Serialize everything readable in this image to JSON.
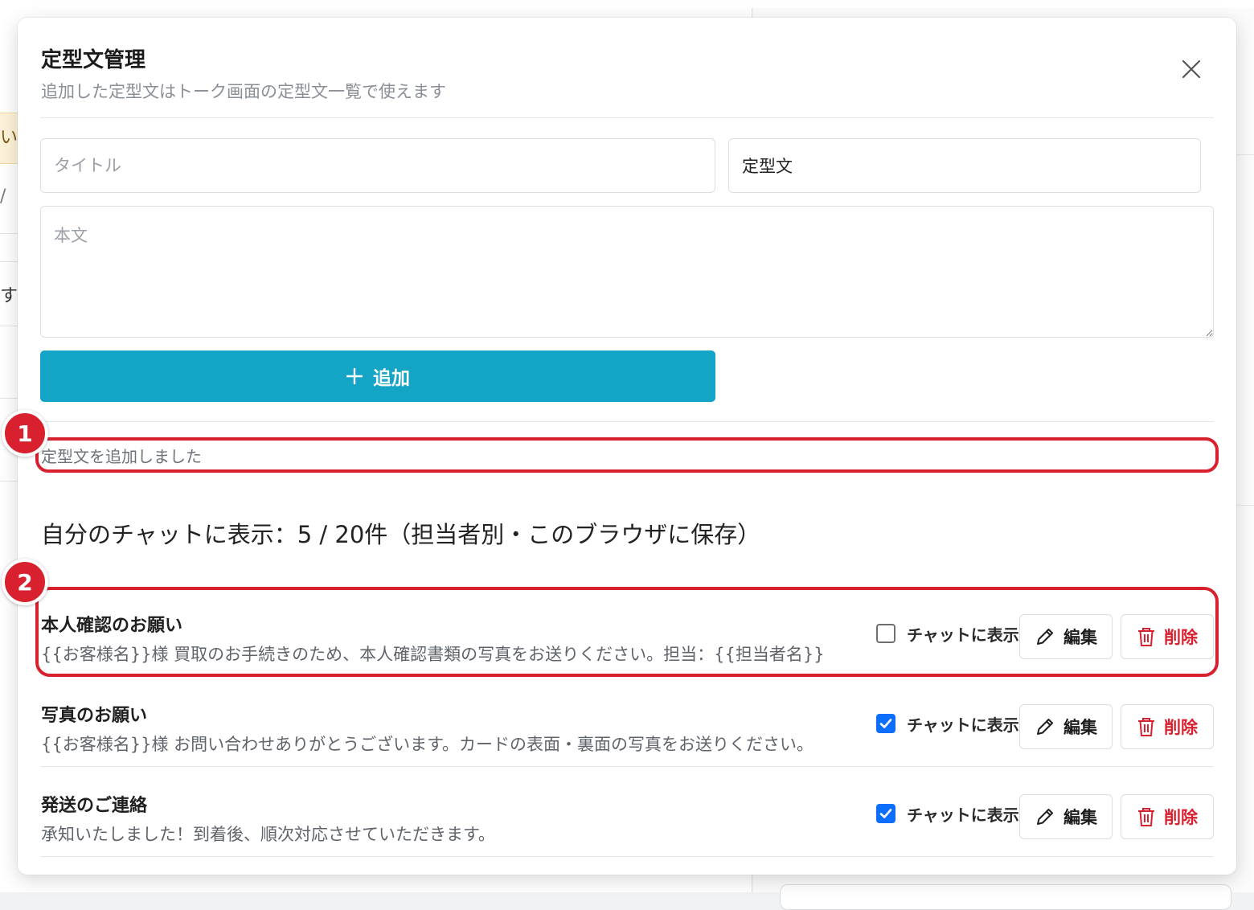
{
  "modal": {
    "title": "定型文管理",
    "subtitle": "追加した定型文はトーク画面の定型文一覧で使えます"
  },
  "form": {
    "title_placeholder": "タイトル",
    "kind_value": "定型文",
    "body_placeholder": "本文",
    "add_label": "追加"
  },
  "flash_message": "定型文を追加しました",
  "count_line": "自分のチャットに表示：5 / 20件（担当者別・このブラウザに保存）",
  "badges": [
    "1",
    "2"
  ],
  "templates": [
    {
      "title": "本人確認のお願い",
      "body": "{{お客様名}}様 買取のお手続きのため、本人確認書類の写真をお送りください。担当：{{担当者名}}",
      "show_in_chat": false,
      "show_label": "チャットに表示",
      "edit_label": "編集",
      "delete_label": "削除"
    },
    {
      "title": "写真のお願い",
      "body": "{{お客様名}}様 お問い合わせありがとうございます。カードの表面・裏面の写真をお送りください。",
      "show_in_chat": true,
      "show_label": "チャットに表示",
      "edit_label": "編集",
      "delete_label": "削除"
    },
    {
      "title": "発送のご連絡",
      "body": "承知いたしました！到着後、順次対応させていただきます。",
      "show_in_chat": true,
      "show_label": "チャットに表示",
      "edit_label": "編集",
      "delete_label": "削除"
    }
  ],
  "background": {
    "warning_fragment": "い。",
    "frag_1": "/ ",
    "frag_2": "す"
  },
  "colors": {
    "accent": "#14a4c6",
    "danger": "#d8202f",
    "checkbox": "#0d6efd"
  }
}
